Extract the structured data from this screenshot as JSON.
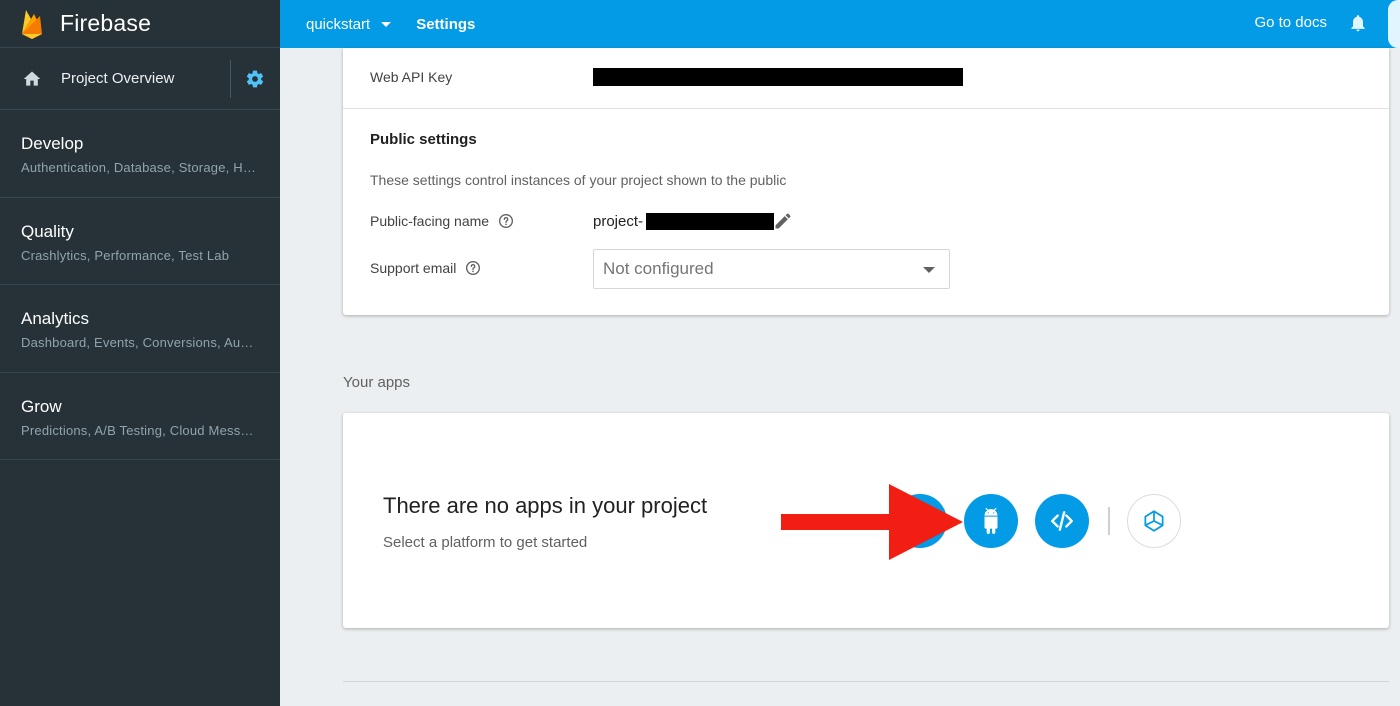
{
  "sidebar": {
    "brand": "Firebase",
    "overview": "Project Overview",
    "sections": [
      {
        "title": "Develop",
        "sub": "Authentication, Database, Storage, Hosting, Functions"
      },
      {
        "title": "Quality",
        "sub": "Crashlytics, Performance, Test Lab"
      },
      {
        "title": "Analytics",
        "sub": "Dashboard, Events, Conversions, Audiences"
      },
      {
        "title": "Grow",
        "sub": "Predictions, A/B Testing, Cloud Messaging"
      }
    ]
  },
  "topbar": {
    "project": "quickstart",
    "breadcrumb": "Settings",
    "docs": "Go to docs"
  },
  "settings": {
    "web_api_key_label": "Web API Key",
    "public_title": "Public settings",
    "public_desc": "These settings control instances of your project shown to the public",
    "public_name_label": "Public-facing name",
    "public_name_value": "project-",
    "support_email_label": "Support email",
    "support_email_value": "Not configured"
  },
  "apps": {
    "section_label": "Your apps",
    "empty_title": "There are no apps in your project",
    "empty_sub": "Select a platform to get started"
  },
  "colors": {
    "sidebar_bg": "#263238",
    "topbar": "#039be5",
    "accent": "#039be5",
    "annotation_arrow": "#f44336"
  },
  "icons": [
    "firebase-logo-icon",
    "home-icon",
    "gear-icon",
    "bell-icon",
    "help-icon",
    "pencil-icon",
    "apple-icon",
    "android-icon",
    "code-icon",
    "unity-icon"
  ]
}
